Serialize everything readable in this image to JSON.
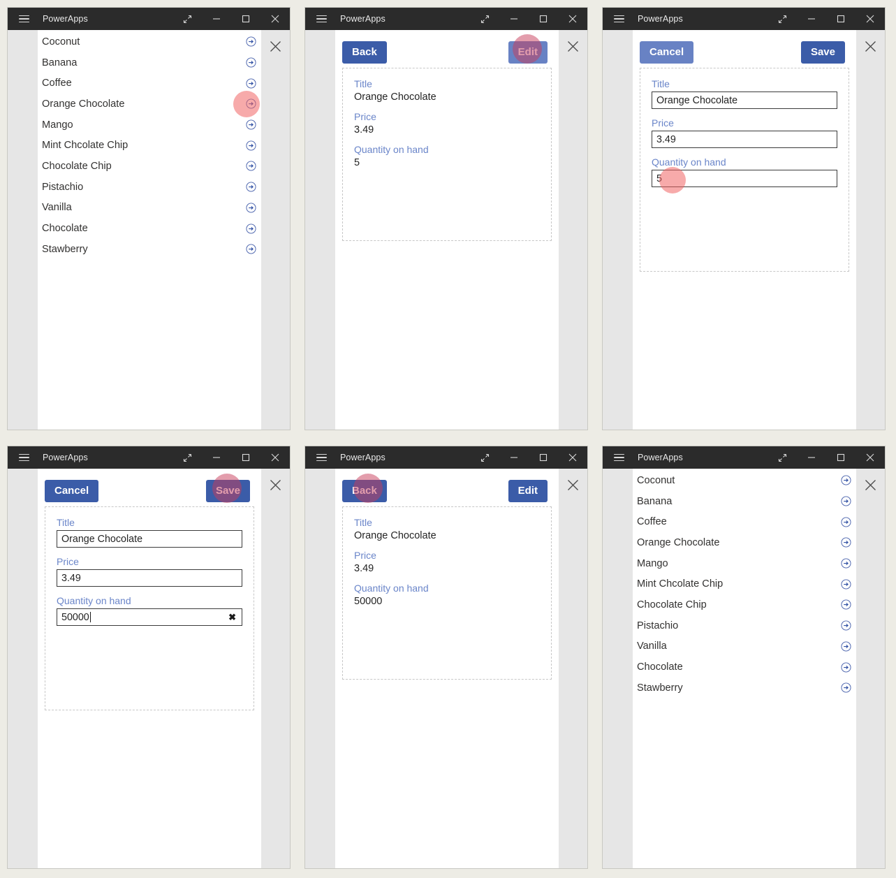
{
  "window": {
    "title": "PowerApps",
    "icons": {
      "menu": "hamburger-icon",
      "restore": "expand-diagonal-icon",
      "minimize": "minimize-icon",
      "maximize": "maximize-icon",
      "close": "close-icon",
      "app_close": "app-close-icon",
      "row_chevron": "circle-arrow-right-icon",
      "clear_field": "clear-x-icon"
    }
  },
  "colors": {
    "page_background": "#edece5",
    "titlebar": "#2b2b2b",
    "app_chrome": "#e6e6e6",
    "canvas": "#ffffff",
    "button_dark": "#3b5ca8",
    "button_light": "#6882c4",
    "field_label": "#6a85c9",
    "chevron": "#4a63ad",
    "click_indicator": "#f06464"
  },
  "list": {
    "items": [
      "Coconut",
      "Banana",
      "Coffee",
      "Orange Chocolate",
      "Mango",
      "Mint Chcolate Chip",
      "Chocolate Chip",
      "Pistachio",
      "Vanilla",
      "Chocolate",
      "Stawberry"
    ]
  },
  "labels": {
    "title": "Title",
    "price": "Price",
    "quantity": "Quantity on hand"
  },
  "buttons": {
    "back": "Back",
    "edit": "Edit",
    "cancel": "Cancel",
    "save": "Save"
  },
  "record": {
    "title": "Orange Chocolate",
    "price": "3.49",
    "quantity_before": "5",
    "quantity_after": "50000"
  },
  "panels": [
    {
      "id": "panel-1-browse",
      "screen": "browse",
      "click_target": "row-chevron-orange-chocolate"
    },
    {
      "id": "panel-2-detail",
      "screen": "detail",
      "quantity": "5",
      "click_target": "edit-button"
    },
    {
      "id": "panel-3-edit",
      "screen": "edit",
      "quantity": "5",
      "click_target": "quantity-input"
    },
    {
      "id": "panel-4-edit-typed",
      "screen": "edit",
      "quantity": "50000",
      "click_target": "save-button"
    },
    {
      "id": "panel-5-detail-updated",
      "screen": "detail",
      "quantity": "50000",
      "click_target": "back-button"
    },
    {
      "id": "panel-6-browse",
      "screen": "browse",
      "click_target": "none"
    }
  ]
}
